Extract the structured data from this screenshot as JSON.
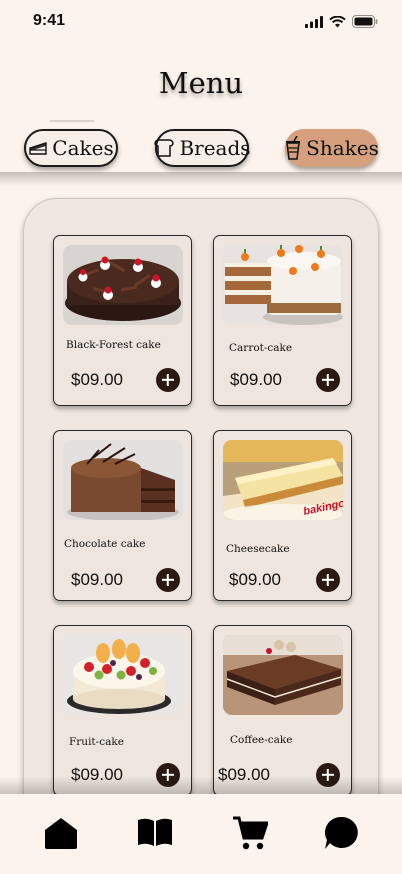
{
  "status_bar": {
    "time": "9:41"
  },
  "header": {
    "title": "Menu"
  },
  "tabs": [
    {
      "label": "Cakes",
      "icon": "cake-icon",
      "active": false
    },
    {
      "label": "Breads",
      "icon": "bread-icon",
      "active": false
    },
    {
      "label": "Shakes",
      "icon": "shake-icon",
      "active": true
    }
  ],
  "products": [
    {
      "name": "Black-Forest cake",
      "price": "$09.00",
      "image": "black-forest-cake-photo"
    },
    {
      "name": "Carrot-cake",
      "price": "$09.00",
      "image": "carrot-cake-photo"
    },
    {
      "name": "Chocolate cake",
      "price": "$09.00",
      "image": "chocolate-cake-photo"
    },
    {
      "name": "Cheesecake",
      "price": "$09.00",
      "image": "cheesecake-photo",
      "image_text": "bakingo"
    },
    {
      "name": "Fruit-cake",
      "price": "$09.00",
      "image": "fruit-cake-photo"
    },
    {
      "name": "Coffee-cake",
      "price": "$09.00",
      "image": "coffee-cake-photo"
    }
  ],
  "bottom_nav": [
    {
      "icon": "home-icon"
    },
    {
      "icon": "menu-book-icon"
    },
    {
      "icon": "cart-icon"
    },
    {
      "icon": "chat-icon"
    }
  ],
  "colors": {
    "background": "#fcf4ec",
    "active_tab": "#d6a07e",
    "add_button": "#2a1a12",
    "panel": "#efe7e0"
  }
}
